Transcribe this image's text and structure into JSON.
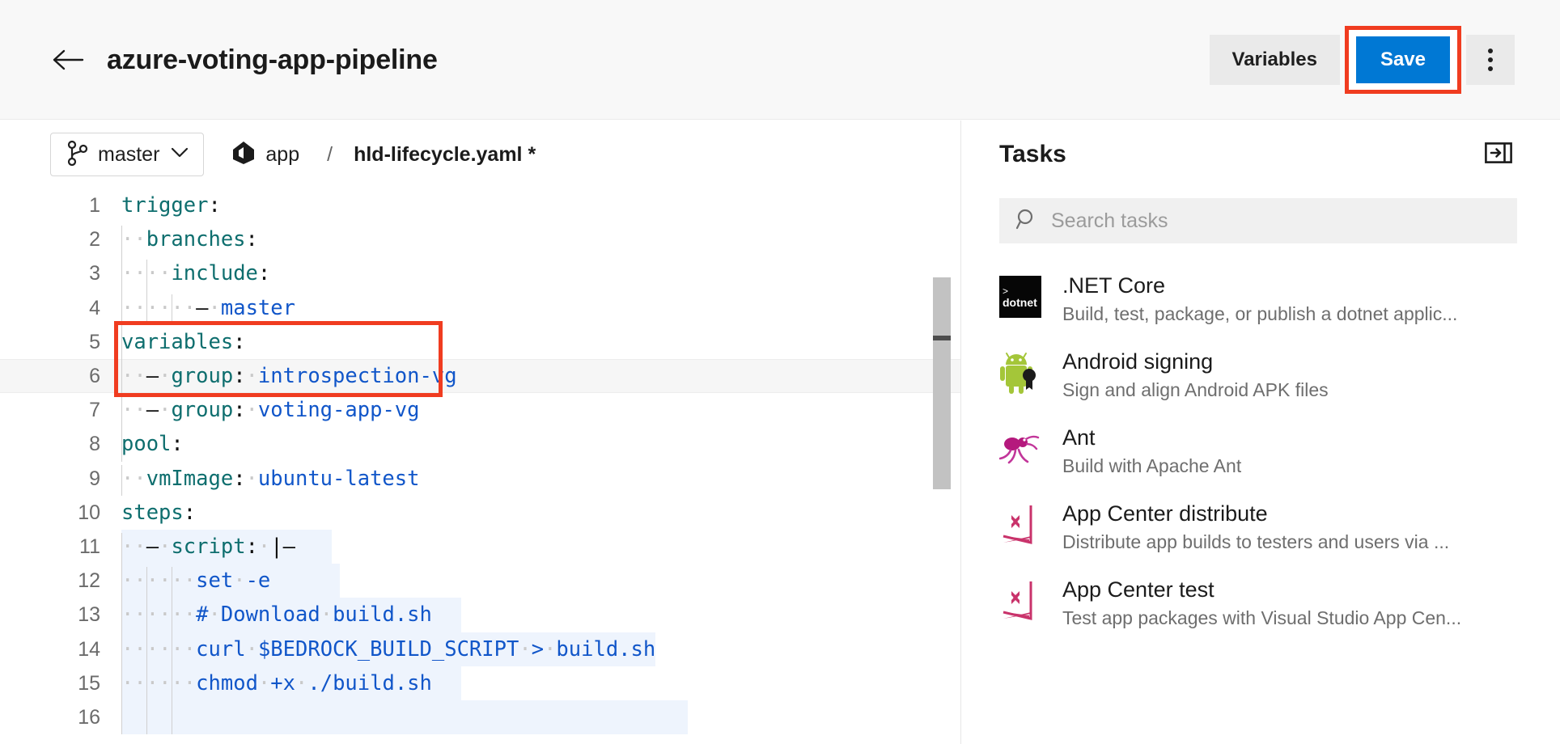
{
  "header": {
    "back_icon": "arrow-left-icon",
    "title": "azure-voting-app-pipeline",
    "variables_label": "Variables",
    "save_label": "Save",
    "more_icon": "more-vertical-icon",
    "accent_color": "#0078d4",
    "annotation_color": "#f03c20"
  },
  "toolbar": {
    "branch_icon": "git-branch-icon",
    "branch": "master",
    "chevron_icon": "chevron-down-icon",
    "repo_icon": "azure-repos-icon",
    "repo": "app",
    "separator": "/",
    "file": "hld-lifecycle.yaml *"
  },
  "editor": {
    "language": "yaml",
    "current_line": 6,
    "lines": [
      {
        "n": "1",
        "indent": 0,
        "text": "trigger:"
      },
      {
        "n": "2",
        "indent": 1,
        "text": "  branches:"
      },
      {
        "n": "3",
        "indent": 2,
        "text": "    include:"
      },
      {
        "n": "4",
        "indent": 3,
        "text": "      - master"
      },
      {
        "n": "5",
        "indent": 0,
        "text": "variables:"
      },
      {
        "n": "6",
        "indent": 1,
        "text": "  - group: introspection-vg"
      },
      {
        "n": "7",
        "indent": 1,
        "text": "  - group: voting-app-vg"
      },
      {
        "n": "8",
        "indent": 0,
        "text": "pool:"
      },
      {
        "n": "9",
        "indent": 1,
        "text": "  vmImage: ubuntu-latest"
      },
      {
        "n": "10",
        "indent": 0,
        "text": "steps:"
      },
      {
        "n": "11",
        "indent": 1,
        "text": "  - script: |-"
      },
      {
        "n": "12",
        "indent": 3,
        "text": "      set -e"
      },
      {
        "n": "13",
        "indent": 3,
        "text": "      # Download build.sh"
      },
      {
        "n": "14",
        "indent": 3,
        "text": "      curl $BEDROCK_BUILD_SCRIPT > build.sh"
      },
      {
        "n": "15",
        "indent": 3,
        "text": "      chmod +x ./build.sh"
      },
      {
        "n": "16",
        "indent": 3,
        "text": ""
      }
    ],
    "colors": {
      "key": "#0e6e6e",
      "value": "#1156c9",
      "punctuation": "#111111",
      "selection": "#eef4fd",
      "current_line": "#f6f6f6"
    }
  },
  "tasks": {
    "title": "Tasks",
    "collapse_icon": "collapse-panel-icon",
    "search": {
      "icon": "search-icon",
      "placeholder": "Search tasks",
      "value": ""
    },
    "items": [
      {
        "icon": "dotnet-icon",
        "name": ".NET Core",
        "description": "Build, test, package, or publish a dotnet applic..."
      },
      {
        "icon": "android-icon",
        "name": "Android signing",
        "description": "Sign and align Android APK files"
      },
      {
        "icon": "ant-icon",
        "name": "Ant",
        "description": "Build with Apache Ant"
      },
      {
        "icon": "app-center-icon",
        "name": "App Center distribute",
        "description": "Distribute app builds to testers and users via ..."
      },
      {
        "icon": "app-center-icon",
        "name": "App Center test",
        "description": "Test app packages with Visual Studio App Cen..."
      }
    ]
  }
}
